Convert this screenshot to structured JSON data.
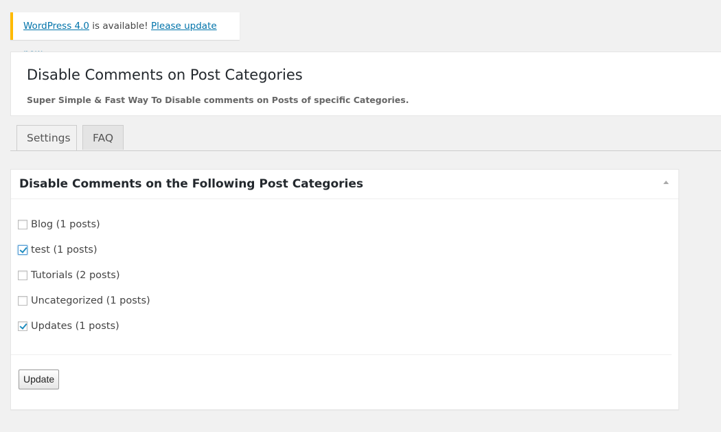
{
  "notice": {
    "link1": "WordPress 4.0",
    "text": " is available! ",
    "link2": "Please update now",
    "end": "."
  },
  "header": {
    "title": "Disable Comments on Post Categories",
    "subtitle": "Super Simple & Fast Way To Disable comments on Posts of specific Categories."
  },
  "tabs": [
    {
      "label": "Settings"
    },
    {
      "label": "FAQ"
    }
  ],
  "box": {
    "title": "Disable Comments on the Following Post Categories",
    "items": [
      {
        "label": "Blog (1 posts)",
        "checked": false
      },
      {
        "label": "test (1 posts)",
        "checked": true
      },
      {
        "label": "Tutorials (2 posts)",
        "checked": false
      },
      {
        "label": "Uncategorized (1 posts)",
        "checked": false
      },
      {
        "label": "Updates (1 posts)",
        "checked": true
      }
    ],
    "button": "Update"
  }
}
